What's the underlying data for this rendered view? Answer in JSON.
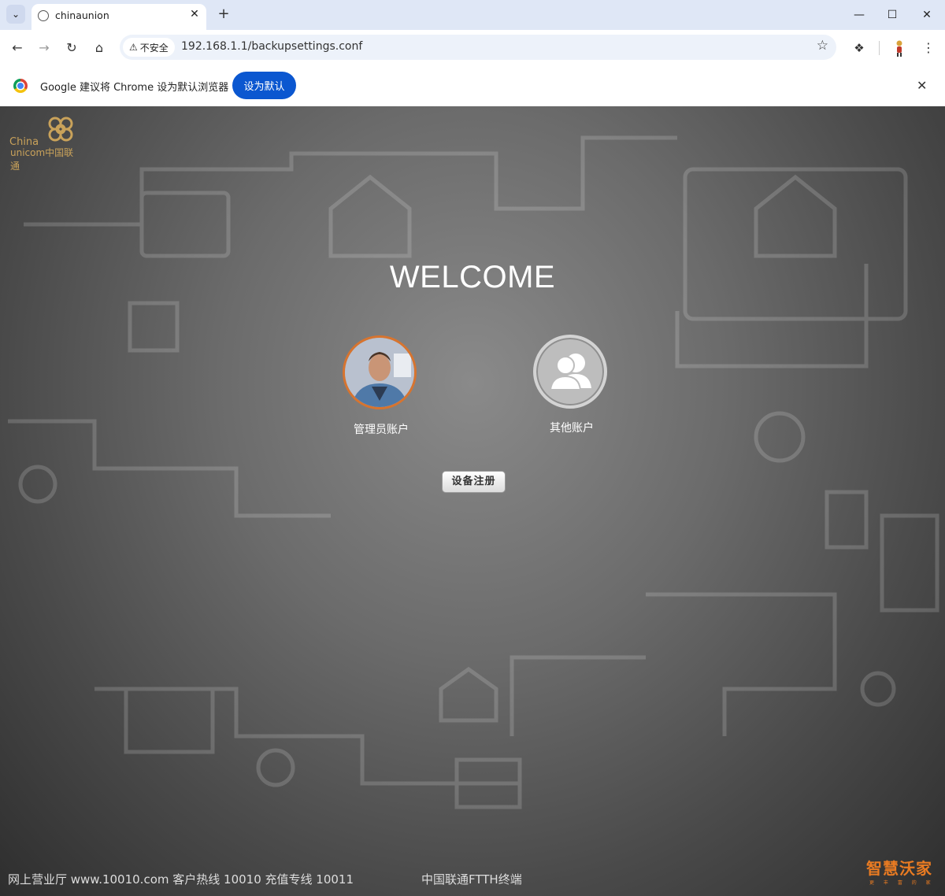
{
  "browser": {
    "tab_title": "chinaunion",
    "security_label": "不安全",
    "url": "192.168.1.1/backupsettings.conf",
    "infobar_message": "Google 建议将 Chrome 设为默认浏览器",
    "infobar_button": "设为默认"
  },
  "page": {
    "logo": {
      "line1": "China",
      "line2": "unicom中国联通"
    },
    "welcome": "WELCOME",
    "accounts": [
      {
        "label": "管理员账户"
      },
      {
        "label": "其他账户"
      }
    ],
    "register_button": "设备注册",
    "footer_left": "网上营业厅 www.10010.com 客户热线 10010 充值专线 10011",
    "footer_center": "中国联通FTTH终端",
    "brand": "智慧沃家",
    "brand_tagline": "更 丰 富 的 家"
  },
  "colors": {
    "accent_orange": "#e97b22",
    "logo_gold": "#c9a25a",
    "chrome_blue": "#0b57d0"
  }
}
